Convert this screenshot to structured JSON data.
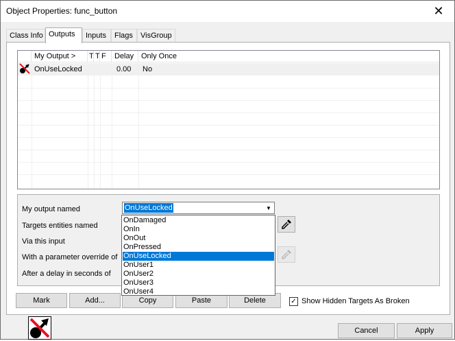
{
  "window": {
    "title": "Object Properties: func_button",
    "close_glyph": "✕"
  },
  "tabs": [
    {
      "label": "Class Info",
      "active": false
    },
    {
      "label": "Outputs",
      "active": true
    },
    {
      "label": "Inputs",
      "active": false
    },
    {
      "label": "Flags",
      "active": false
    },
    {
      "label": "VisGroup",
      "active": false
    }
  ],
  "outputs_list": {
    "columns": [
      "My Output  >",
      "T",
      "T",
      "F",
      "Delay",
      "Only Once"
    ],
    "rows": [
      {
        "icon": "broken-output-icon",
        "output": "OnUseLocked",
        "delay": "0.00",
        "only_once": "No"
      }
    ]
  },
  "props": {
    "output_named_label": "My output named",
    "output_named_value": "OnUseLocked",
    "targets_label": "Targets entities named",
    "via_input_label": "Via this input",
    "param_label": "With a parameter override of",
    "delay_label": "After a delay in seconds of"
  },
  "dropdown": {
    "options": [
      "OnDamaged",
      "OnIn",
      "OnOut",
      "OnPressed",
      "OnUseLocked",
      "OnUser1",
      "OnUser2",
      "OnUser3",
      "OnUser4"
    ],
    "selected": "OnUseLocked"
  },
  "buttons": {
    "mark": "Mark",
    "add": "Add...",
    "copy": "Copy",
    "paste": "Paste",
    "delete": "Delete",
    "cancel": "Cancel",
    "apply": "Apply"
  },
  "show_hidden": {
    "label": "Show Hidden Targets As Broken",
    "checked": true
  },
  "icons": {
    "close": "close-icon",
    "eyedropper": "eyedropper-icon",
    "dropdown_arrow": "chevron-down-icon",
    "output_status": "broken-output-icon"
  },
  "colors": {
    "accent": "#0078d7",
    "broken_slash": "#e81123"
  }
}
